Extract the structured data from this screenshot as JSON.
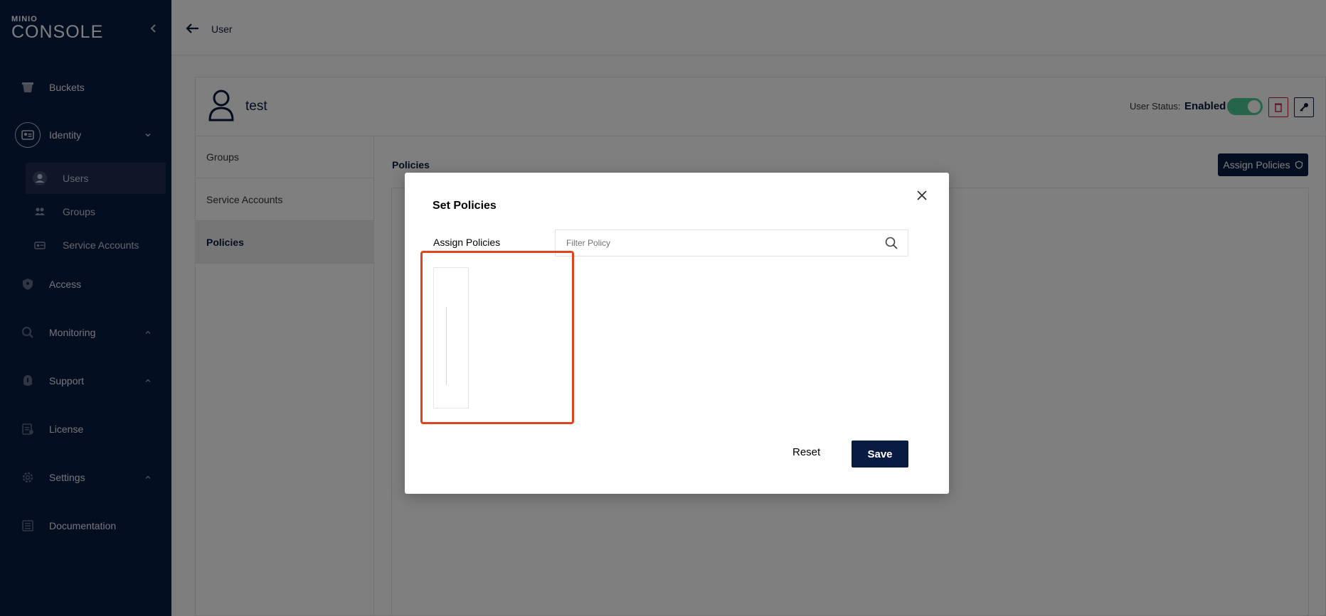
{
  "sidebar": {
    "logo_top": "MINIO",
    "logo_bottom": "CONSOLE",
    "items": {
      "buckets": "Buckets",
      "identity": "Identity",
      "access": "Access",
      "monitoring": "Monitoring",
      "support": "Support",
      "license": "License",
      "settings": "Settings",
      "documentation": "Documentation"
    },
    "identity_sub": {
      "users": "Users",
      "groups": "Groups",
      "service_accounts": "Service Accounts"
    }
  },
  "header": {
    "title": "User"
  },
  "user": {
    "name": "test",
    "status_label": "User Status:",
    "status_value": "Enabled",
    "enabled": true
  },
  "tabs": {
    "groups": "Groups",
    "service_accounts": "Service Accounts",
    "policies": "Policies"
  },
  "policies_panel": {
    "title": "Policies",
    "assign_button": "Assign Policies"
  },
  "modal": {
    "title": "Set Policies",
    "assign_label": "Assign Policies",
    "filter_placeholder": "Filter Policy",
    "reset_label": "Reset",
    "save_label": "Save"
  },
  "colors": {
    "navy": "#081c42",
    "toggle_on": "#4ccb92",
    "highlight": "#e0441c",
    "danger": "#c51b3f"
  }
}
